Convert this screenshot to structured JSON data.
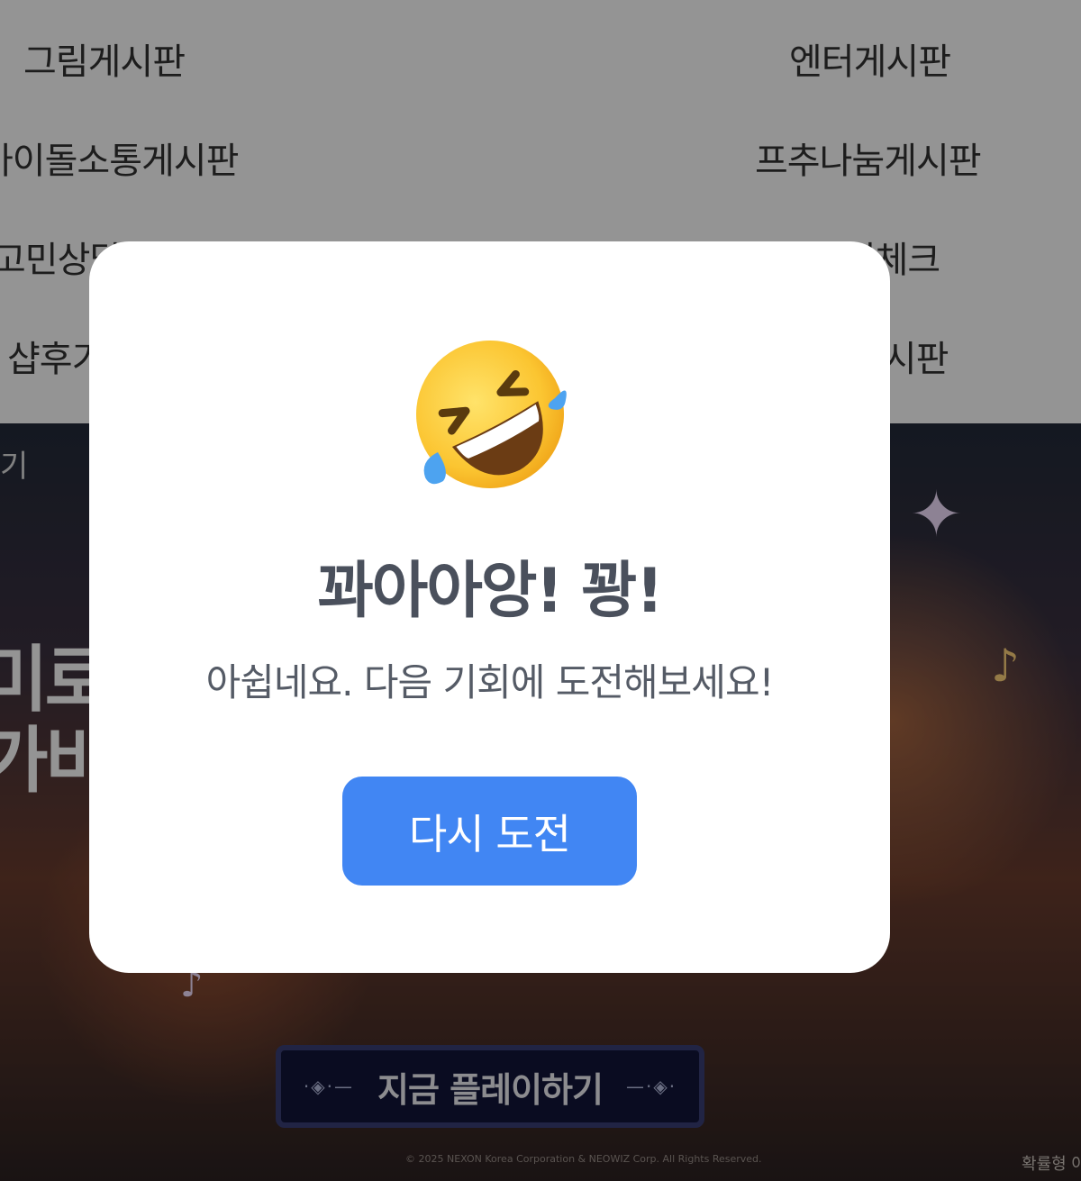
{
  "board_menu": {
    "items": [
      {
        "label": "그림게시판"
      },
      {
        "label": "엔터게시판"
      },
      {
        "label": "아이돌소통게시판"
      },
      {
        "label": "프추나눔게시판"
      },
      {
        "label": "고민상담게시판"
      },
      {
        "label": "출석체크"
      },
      {
        "label": "샵후기게시판"
      },
      {
        "label": "게시판"
      }
    ]
  },
  "banner": {
    "small_text": "기",
    "headline_1": "미로",
    "headline_2": "가비",
    "play_button_label": "지금 플레이하기",
    "copyright": "© 2025 NEXON Korea Corporation & NEOWIZ Corp. All Rights Reserved.",
    "probability_note": "확률형 아"
  },
  "modal": {
    "emoji_name": "rolling-on-floor-laughing-icon",
    "title": "꽈아아앙! 꽝!",
    "message": "아쉽네요. 다음 기회에 도전해보세요!",
    "retry_button_label": "다시 도전",
    "accent_color": "#4186f3"
  }
}
